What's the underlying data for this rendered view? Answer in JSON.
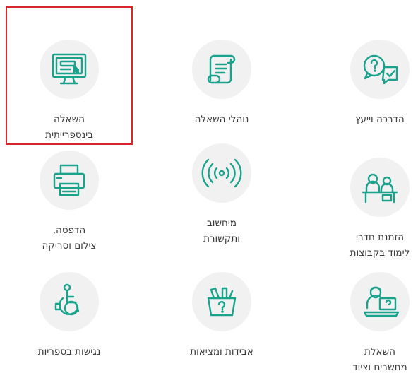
{
  "accent_color": "#1aa38c",
  "highlight_color": "#d9262d",
  "tiles": [
    {
      "label": "השאלה\nבינספרייתית",
      "icon": "computer-monitor-icon"
    },
    {
      "label": "נוהלי השאלה",
      "icon": "scroll-document-icon"
    },
    {
      "label": "הדרכה וייעץ",
      "icon": "question-chat-icon"
    },
    {
      "label": "הדפסה,\nצילום וסריקה",
      "icon": "printer-icon"
    },
    {
      "label": "מיחשוב\nותקשורת",
      "icon": "wireless-signal-icon"
    },
    {
      "label": "הזמנת חדרי\nלימוד בקבוצות",
      "icon": "group-study-room-icon"
    },
    {
      "label": "נגישות בספריות",
      "icon": "wheelchair-icon"
    },
    {
      "label": "אבידות ומציאות",
      "icon": "lost-found-box-icon"
    },
    {
      "label": "השאלת\nמחשבים וציוד",
      "icon": "laptop-user-icon"
    }
  ]
}
